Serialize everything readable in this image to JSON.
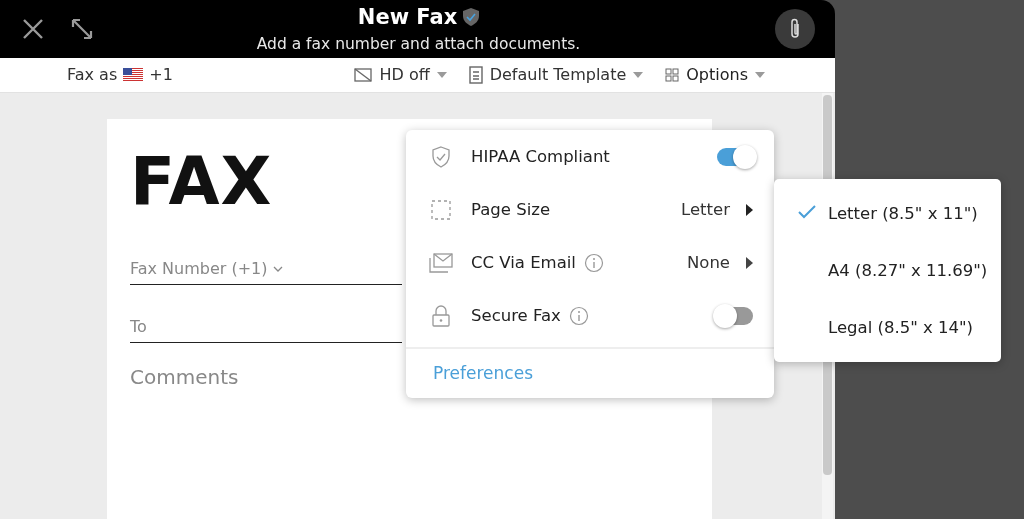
{
  "window": {
    "title": "New Fax",
    "subtitle": "Add a fax number and attach documents."
  },
  "toolbar": {
    "fax_as_label": "Fax as",
    "country_code": "+1",
    "hd": {
      "label": "HD off"
    },
    "template": {
      "label": "Default Template"
    },
    "options": {
      "label": "Options",
      "expanded": true
    }
  },
  "document": {
    "heading": "FAX",
    "fields": [
      {
        "kind": "dropdown",
        "placeholder": "Fax Number (+1)"
      },
      {
        "kind": "line",
        "placeholder": "To"
      },
      {
        "kind": "area",
        "placeholder": "Comments"
      }
    ]
  },
  "options_menu": {
    "items": [
      {
        "kind": "toggle",
        "label": "HIPAA Compliant",
        "info": false,
        "on": true
      },
      {
        "kind": "submenu",
        "label": "Page Size",
        "info": false,
        "value": "Letter",
        "expanded": true
      },
      {
        "kind": "submenu",
        "label": "CC Via Email",
        "info": true,
        "value": "None",
        "expanded": false
      },
      {
        "kind": "toggle",
        "label": "Secure Fax",
        "info": true,
        "on": false
      }
    ],
    "footer_link": "Preferences"
  },
  "page_size_menu": [
    {
      "label": "Letter (8.5\" x 11\")",
      "selected": true
    },
    {
      "label": "A4 (8.27\" x 11.69\")",
      "selected": false
    },
    {
      "label": "Legal (8.5\" x 14\")",
      "selected": false
    }
  ]
}
